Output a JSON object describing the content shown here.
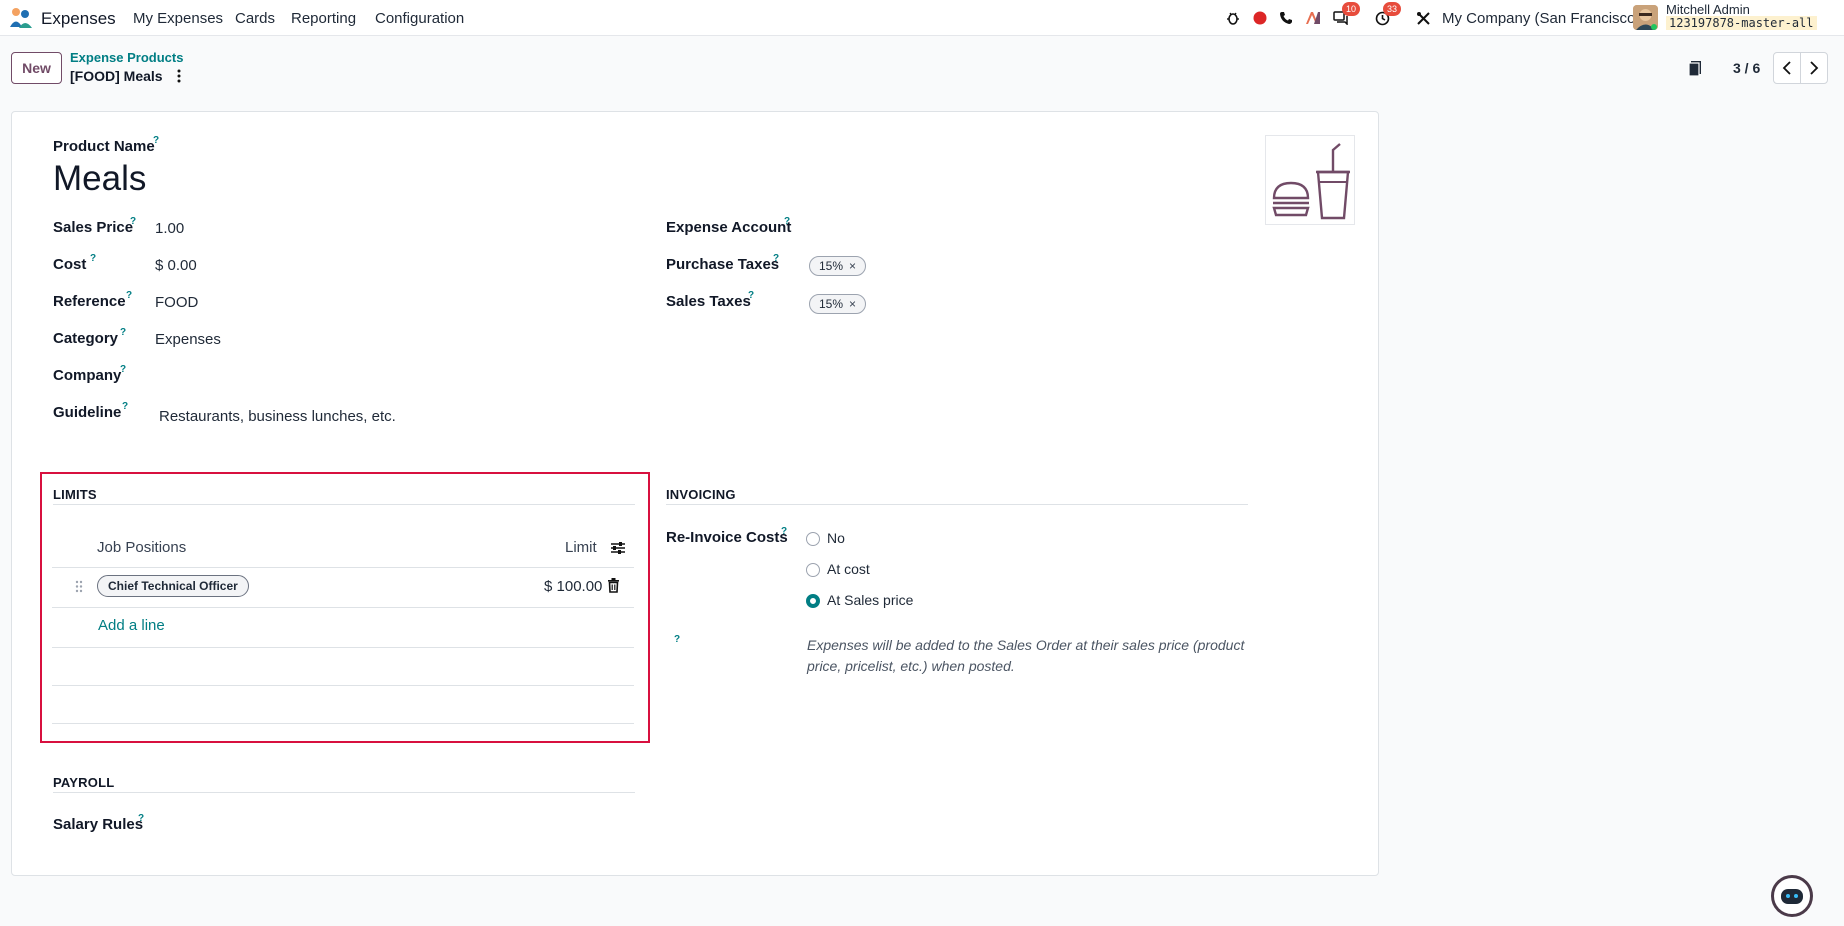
{
  "navbar": {
    "app_name": "Expenses",
    "menu": [
      "My Expenses",
      "Cards",
      "Reporting",
      "Configuration"
    ],
    "messages_count": "10",
    "activities_count": "33",
    "company": "My Company (San Francisco)",
    "user_name": "Mitchell Admin",
    "database": "123197878-master-all",
    "icons": [
      "bug-icon",
      "record-icon",
      "phone-icon",
      "ai-icon",
      "chat-icon",
      "clock-icon",
      "tools-icon"
    ]
  },
  "control_panel": {
    "new_label": "New",
    "breadcrumb_parent": "Expense Products",
    "breadcrumb_current": "[FOOD] Meals",
    "pager": "3 / 6"
  },
  "form": {
    "product_name_label": "Product Name",
    "product_name": "Meals",
    "help_mark": "?",
    "left_fields": [
      {
        "label": "Sales Price",
        "value": "1.00"
      },
      {
        "label": "Cost",
        "value": "$ 0.00"
      },
      {
        "label": "Reference",
        "value": "FOOD"
      },
      {
        "label": "Category",
        "value": "Expenses"
      },
      {
        "label": "Company",
        "value": ""
      },
      {
        "label": "Guideline",
        "value": "Restaurants, business lunches, etc."
      }
    ],
    "right_fields": {
      "expense_account_label": "Expense Account",
      "purchase_taxes_label": "Purchase Taxes",
      "purchase_taxes": "15%",
      "sales_taxes_label": "Sales Taxes",
      "sales_taxes": "15%",
      "tag_remove": "×"
    },
    "limits": {
      "title": "LIMITS",
      "col_job": "Job Positions",
      "col_limit": "Limit",
      "rows": [
        {
          "job": "Chief Technical Officer",
          "limit": "$ 100.00"
        }
      ],
      "add_line": "Add a line"
    },
    "invoicing": {
      "title": "INVOICING",
      "reinvoice_label": "Re-Invoice Costs",
      "options": [
        "No",
        "At cost",
        "At Sales price"
      ],
      "selected": "At Sales price",
      "note": "Expenses will be added to the Sales Order at their sales price (product price, pricelist, etc.) when posted."
    },
    "payroll": {
      "title": "PAYROLL",
      "salary_rules_label": "Salary Rules"
    }
  }
}
